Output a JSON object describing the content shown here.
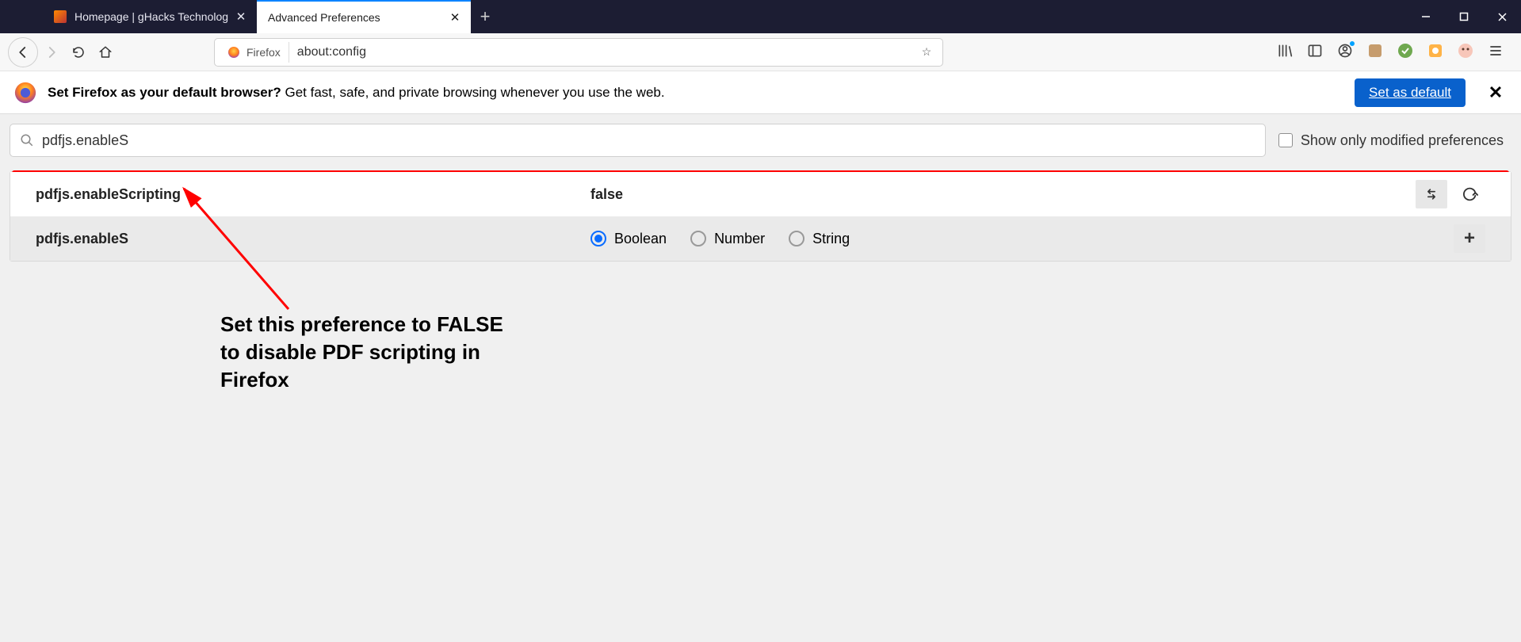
{
  "tabs": {
    "inactive": {
      "title": "Homepage | gHacks Technolog"
    },
    "active": {
      "title": "Advanced Preferences"
    }
  },
  "urlbar": {
    "identity_label": "Firefox",
    "address": "about:config"
  },
  "infobar": {
    "bold": "Set Firefox as your default browser?",
    "rest": " Get fast, safe, and private browsing whenever you use the web.",
    "button": "Set as default"
  },
  "config": {
    "search_value": "pdfjs.enableS",
    "show_modified_label": "Show only modified preferences",
    "row1": {
      "name": "pdfjs.enableScripting",
      "value": "false"
    },
    "row2": {
      "name": "pdfjs.enableS",
      "types": {
        "boolean": "Boolean",
        "number": "Number",
        "string": "String"
      }
    }
  },
  "annotation": {
    "line1": "Set this preference to FALSE",
    "line2": "to disable PDF scripting in",
    "line3": "Firefox"
  }
}
